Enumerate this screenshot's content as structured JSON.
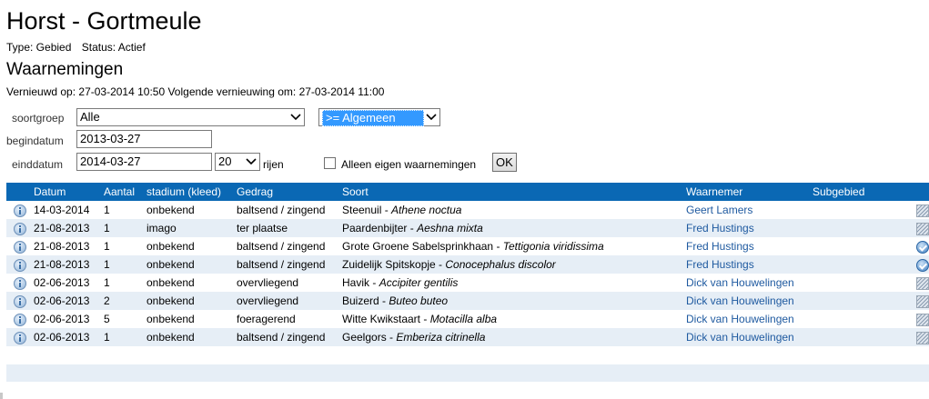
{
  "header": {
    "title": "Horst - Gortmeule",
    "type_text": "Type: Gebied",
    "status_text": "Status: Actief"
  },
  "section": {
    "title": "Waarnemingen",
    "refresh_text": "Vernieuwd op: 27-03-2014 10:50 Volgende vernieuwing om: 27-03-2014 11:00"
  },
  "filters": {
    "soortgroep_label": "soortgroep",
    "soortgroep_value": "Alle",
    "zeldzaamheid_value": ">= Algemeen",
    "begindatum_label": "begindatum",
    "begindatum_value": "2013-03-27",
    "einddatum_label": "einddatum",
    "einddatum_value": "2014-03-27",
    "rows_value": "20",
    "rows_label": "rijen",
    "own_label": "Alleen eigen waarnemingen",
    "own_checked": false,
    "ok_label": "OK"
  },
  "table": {
    "headers": {
      "datum": "Datum",
      "aantal": "Aantal",
      "stadium": "stadium (kleed)",
      "gedrag": "Gedrag",
      "soort": "Soort",
      "waarnemer": "Waarnemer",
      "subgebied": "Subgebied"
    },
    "rows": [
      {
        "datum": "14-03-2014",
        "aantal": "1",
        "stadium": "onbekend",
        "gedrag": "baltsend / zingend",
        "soort": "Steenuil",
        "sci": "Athene noctua",
        "waarnemer": "Geert Lamers",
        "subgebied": "",
        "status_icon": "hatch-icon"
      },
      {
        "datum": "21-08-2013",
        "aantal": "1",
        "stadium": "imago",
        "gedrag": "ter plaatse",
        "soort": "Paardenbijter",
        "sci": "Aeshna mixta",
        "waarnemer": "Fred Hustings",
        "subgebied": "",
        "status_icon": "hatch-icon"
      },
      {
        "datum": "21-08-2013",
        "aantal": "1",
        "stadium": "onbekend",
        "gedrag": "baltsend / zingend",
        "soort": "Grote Groene Sabelsprinkhaan",
        "sci": "Tettigonia viridissima",
        "waarnemer": "Fred Hustings",
        "subgebied": "",
        "status_icon": "check-icon"
      },
      {
        "datum": "21-08-2013",
        "aantal": "1",
        "stadium": "onbekend",
        "gedrag": "baltsend / zingend",
        "soort": "Zuidelijk Spitskopje",
        "sci": "Conocephalus discolor",
        "waarnemer": "Fred Hustings",
        "subgebied": "",
        "status_icon": "check-icon"
      },
      {
        "datum": "02-06-2013",
        "aantal": "1",
        "stadium": "onbekend",
        "gedrag": "overvliegend",
        "soort": "Havik",
        "sci": "Accipiter gentilis",
        "waarnemer": "Dick van Houwelingen",
        "subgebied": "",
        "status_icon": "hatch-icon"
      },
      {
        "datum": "02-06-2013",
        "aantal": "2",
        "stadium": "onbekend",
        "gedrag": "overvliegend",
        "soort": "Buizerd",
        "sci": "Buteo buteo",
        "waarnemer": "Dick van Houwelingen",
        "subgebied": "",
        "status_icon": "hatch-icon"
      },
      {
        "datum": "02-06-2013",
        "aantal": "5",
        "stadium": "onbekend",
        "gedrag": "foeragerend",
        "soort": "Witte Kwikstaart",
        "sci": "Motacilla alba",
        "waarnemer": "Dick van Houwelingen",
        "subgebied": "",
        "status_icon": "hatch-icon"
      },
      {
        "datum": "02-06-2013",
        "aantal": "1",
        "stadium": "onbekend",
        "gedrag": "baltsend / zingend",
        "soort": "Geelgors",
        "sci": "Emberiza citrinella",
        "waarnemer": "Dick van Houwelingen",
        "subgebied": "",
        "status_icon": "hatch-icon"
      }
    ]
  },
  "colors": {
    "header_bg": "#0a68b4",
    "alt_row_bg": "#e6eef6",
    "link": "#1f5aa0",
    "select_highlight": "#3399ff"
  }
}
